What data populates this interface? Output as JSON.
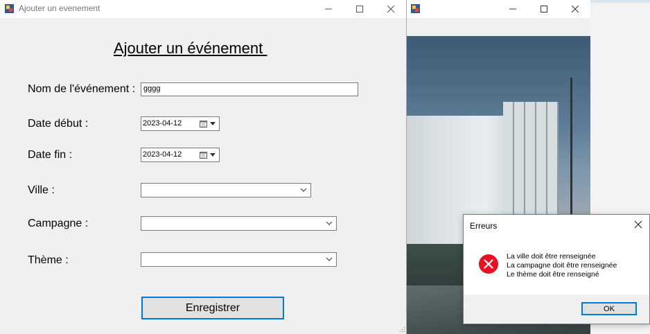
{
  "main_window": {
    "title": "Ajouter un evenement",
    "form_title": "Ajouter un événement ",
    "fields": {
      "name": {
        "label": "Nom de l'événement :",
        "value": "gggg"
      },
      "start_date": {
        "label": "Date début :",
        "value": "2023-04-12"
      },
      "end_date": {
        "label": "Date fin :",
        "value": "2023-04-12"
      },
      "city": {
        "label": "Ville :",
        "value": ""
      },
      "campaign": {
        "label": "Campagne :",
        "value": ""
      },
      "theme": {
        "label": "Thème :",
        "value": ""
      }
    },
    "save_button": "Enregistrer"
  },
  "error_dialog": {
    "title": "Erreurs",
    "messages": [
      "La ville doit être renseignée",
      "La campagne doit être renseignée",
      "Le thème doit être renseigné"
    ],
    "ok_button": "OK"
  },
  "colors": {
    "accent": "#0078d7",
    "error": "#e81123",
    "window_bg": "#f0f0f0"
  },
  "icons": [
    "app-icon",
    "minimize-icon",
    "maximize-icon",
    "close-icon",
    "calendar-icon",
    "chevron-down-icon",
    "error-icon",
    "resize-grip-icon"
  ]
}
